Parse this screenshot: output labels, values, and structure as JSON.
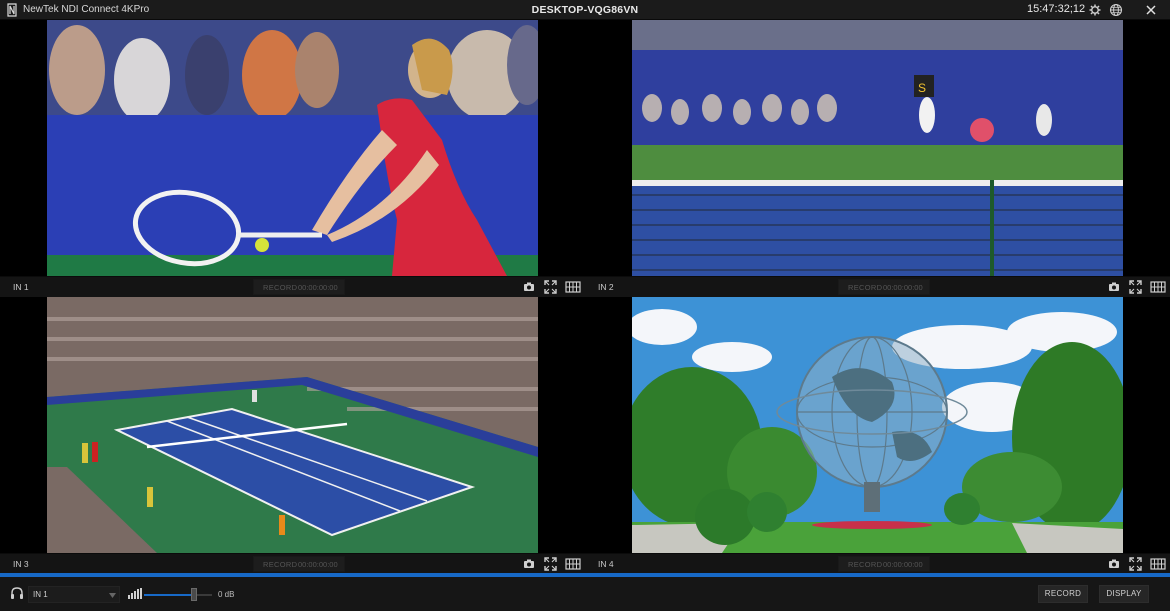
{
  "window": {
    "app_title": "NewTek NDI Connect 4KPro",
    "host_name": "DESKTOP-VQG86VN",
    "timecode": "15:47:32;12",
    "icons": [
      "newtek-logo-icon",
      "gear-icon",
      "globe-icon",
      "close-icon"
    ]
  },
  "inputs": [
    {
      "label": "IN 1",
      "record_label": "RECORD",
      "record_time": "00:00:00:00"
    },
    {
      "label": "IN 2",
      "record_label": "RECORD",
      "record_time": "00:00:00:00"
    },
    {
      "label": "IN 3",
      "record_label": "RECORD",
      "record_time": "00:00:00:00"
    },
    {
      "label": "IN 4",
      "record_label": "RECORD",
      "record_time": "00:00:00:00"
    }
  ],
  "cell_icons": [
    "camera-icon",
    "fullscreen-icon",
    "filmstrip-icon"
  ],
  "bottom": {
    "monitor_source": "IN 1",
    "volume_db": "0 dB",
    "volume_level": 0.72,
    "record_button": "RECORD",
    "display_button": "DISPLAY",
    "icons": [
      "headphones-icon",
      "volume-meter-icon",
      "chevron-down-icon"
    ]
  },
  "colors": {
    "accent": "#1769c7",
    "background": "#000000",
    "panel": "#141414"
  }
}
